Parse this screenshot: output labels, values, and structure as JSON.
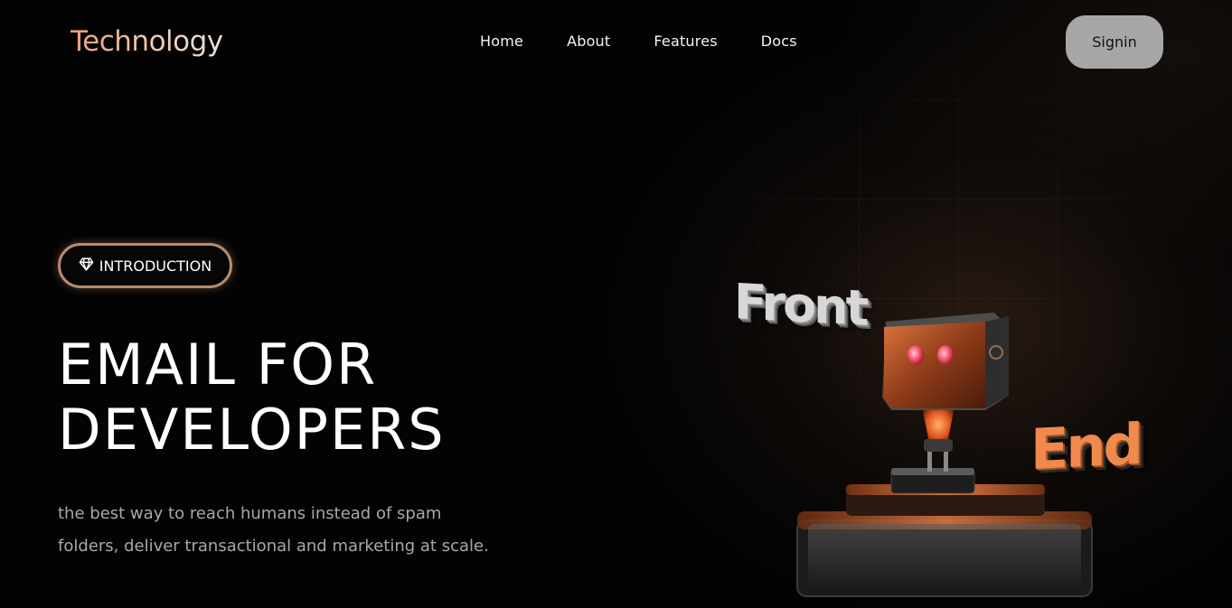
{
  "header": {
    "logo": "Technology",
    "nav": [
      {
        "label": "Home"
      },
      {
        "label": "About"
      },
      {
        "label": "Features"
      },
      {
        "label": "Docs"
      }
    ],
    "signin_label": "Signin"
  },
  "hero": {
    "badge_icon": "diamond-icon",
    "badge_label": "INTRODUCTION",
    "title_line1": "EMAIL FOR",
    "title_line2": "DEVELOPERS",
    "description": "the best way to reach humans instead of spam folders, deliver transactional and marketing at scale."
  },
  "illustration": {
    "word_front": "Front",
    "word_end": "End"
  },
  "colors": {
    "accent": "#ef8a4c",
    "pill_border": "#b98a6c",
    "signin_bg": "#a6a6a6"
  }
}
